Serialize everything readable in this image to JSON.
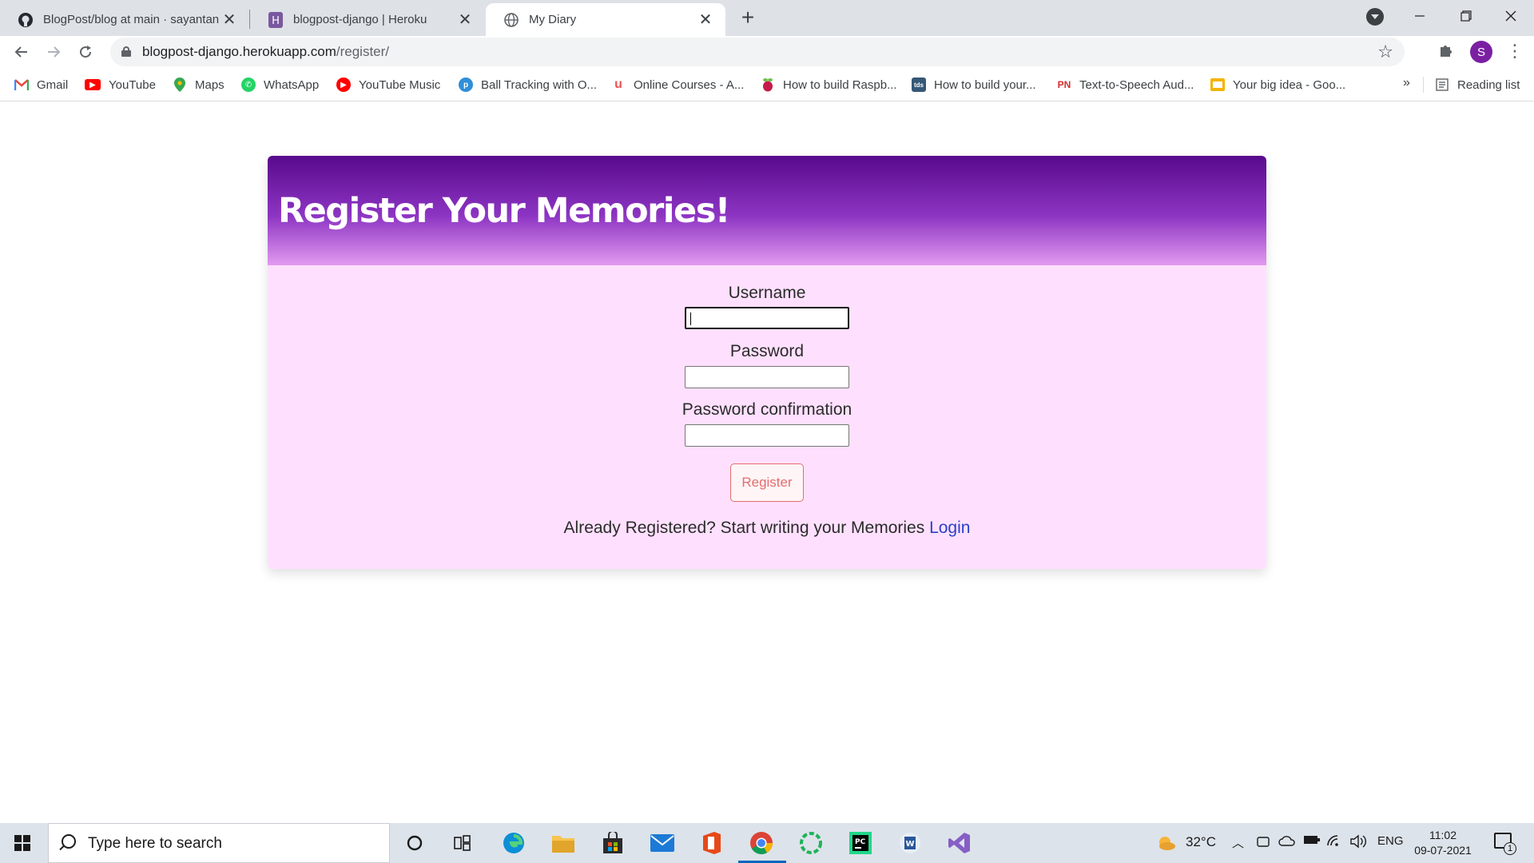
{
  "browser": {
    "tabs": [
      {
        "title": "BlogPost/blog at main · sayantan",
        "icon": "github-icon",
        "active": false
      },
      {
        "title": "blogpost-django | Heroku",
        "icon": "heroku-icon",
        "active": false
      },
      {
        "title": "My Diary",
        "icon": "globe-icon",
        "active": true
      }
    ],
    "close_glyph": "✕",
    "new_tab_glyph": "+",
    "address": {
      "host": "blogpost-django.herokuapp.com",
      "path": "/register/"
    },
    "profile_initial": "S",
    "bookmarks": [
      {
        "label": "Gmail",
        "icon": "gmail-icon",
        "color": "#ea4335"
      },
      {
        "label": "YouTube",
        "icon": "youtube-icon",
        "color": "#ff0000"
      },
      {
        "label": "Maps",
        "icon": "maps-icon",
        "color": "#34a853"
      },
      {
        "label": "WhatsApp",
        "icon": "whatsapp-icon",
        "color": "#25d366"
      },
      {
        "label": "YouTube Music",
        "icon": "youtube-music-icon",
        "color": "#ff0000"
      },
      {
        "label": "Ball Tracking with O...",
        "icon": "pyimagesearch-icon",
        "color": "#2f8fd8"
      },
      {
        "label": "Online Courses - A...",
        "icon": "udemy-icon",
        "color": "#ec5252"
      },
      {
        "label": "How to build Raspb...",
        "icon": "raspberry-icon",
        "color": "#c51a4a"
      },
      {
        "label": "How to build your...",
        "icon": "tds-icon",
        "color": "#355876"
      },
      {
        "label": "Text-to-Speech Aud...",
        "icon": "pn-icon",
        "color": "#d32f2f"
      },
      {
        "label": "Your big idea - Goo...",
        "icon": "google-slides-icon",
        "color": "#f4b400"
      }
    ],
    "bookmarks_overflow": "»",
    "reading_list": "Reading list"
  },
  "page": {
    "heading": "Register Your Memories!",
    "form": {
      "username_label": "Username",
      "username_value": "",
      "password_label": "Password",
      "password_value": "",
      "password_confirm_label": "Password confirmation",
      "password_confirm_value": "",
      "submit_label": "Register"
    },
    "footer_text": "Already Registered? Start writing your Memories",
    "login_link": "Login"
  },
  "taskbar": {
    "search_placeholder": "Type here to search",
    "pinned": [
      "cortana-icon",
      "task-view-icon",
      "edge-icon",
      "file-explorer-icon",
      "store-icon",
      "mail-icon",
      "office-icon",
      "chrome-icon",
      "app-green-icon",
      "pycharm-icon",
      "word-icon",
      "visual-studio-icon"
    ],
    "weather": "32°C",
    "language": "ENG",
    "time": "11:02",
    "date": "09-07-2021",
    "notifications": "1"
  }
}
